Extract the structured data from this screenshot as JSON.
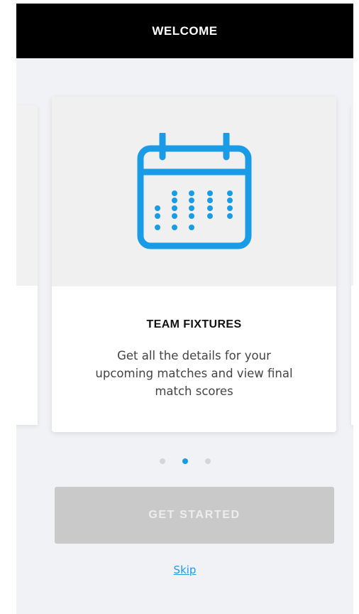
{
  "header": {
    "title": "WELCOME"
  },
  "card": {
    "icon": "calendar-icon",
    "title": "TEAM FIXTURES",
    "description": "Get all the details for your upcoming matches and view final match scores"
  },
  "pagination": {
    "total": 3,
    "active_index": 1
  },
  "cta": {
    "label": "GET STARTED"
  },
  "skip": {
    "label": "Skip"
  },
  "colors": {
    "accent": "#1a9be6",
    "header_bg": "#000000",
    "button_disabled": "#c9c9c9",
    "screen_bg": "#f1f2f5"
  }
}
